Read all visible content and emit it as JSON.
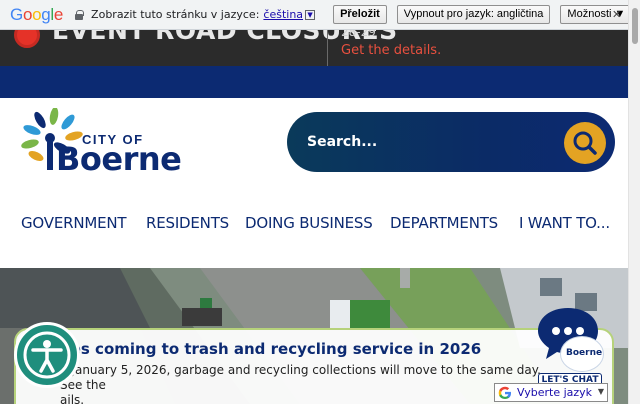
{
  "translate_bar": {
    "logo": "Google",
    "prompt": "Zobrazit tuto stránku v jazyce:",
    "language": "čeština",
    "translate_button": "Přeložit",
    "disable_button": "Vypnout pro jazyk: angličtina",
    "options_button": "Možnosti ▼",
    "close": "✕"
  },
  "alert": {
    "title": "EVENT ROAD CLOSURES",
    "date": "28-29",
    "link": "Get the details."
  },
  "header": {
    "logo_city_of": "CITY OF",
    "logo_name": "Boerne",
    "search_placeholder": "Search..."
  },
  "nav": {
    "items": [
      "GOVERNMENT",
      "RESIDENTS",
      "DOING BUSINESS",
      "DEPARTMENTS",
      "I WANT TO..."
    ]
  },
  "news": {
    "title": "ges coming to trash and recycling service in 2026",
    "body": "g January 5, 2026, garbage and recycling collections will move to the same day. See the",
    "body2": "ails."
  },
  "chat": {
    "label": "LET'S CHAT",
    "logo_text": "Boerne"
  },
  "lang_widget": {
    "label": "Vyberte jazyk",
    "arrow": "▼"
  },
  "colors": {
    "navy": "#0c2a72",
    "gold": "#e3a323",
    "alert_red": "#e53228",
    "access_teal": "#1f8e7d",
    "news_border": "#b6d27b"
  }
}
